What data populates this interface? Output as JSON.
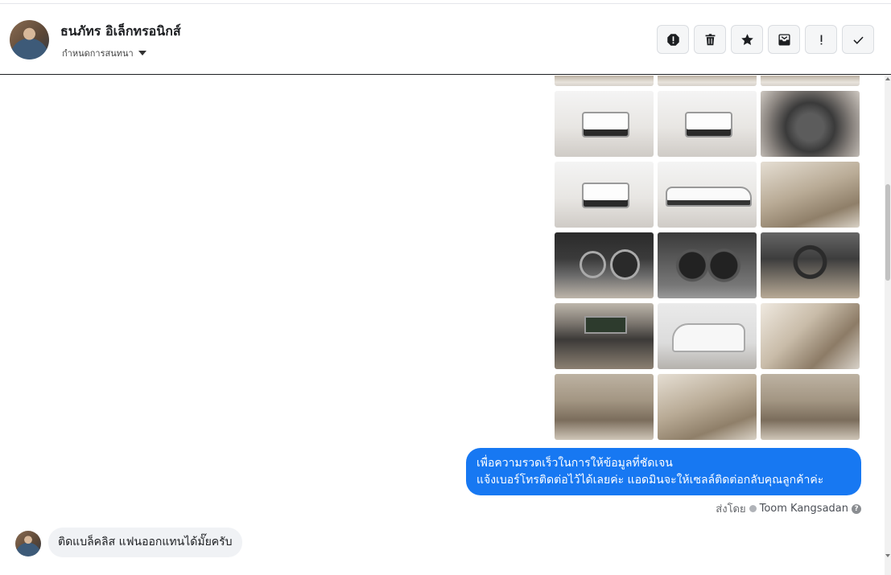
{
  "header": {
    "contact_name": "ธนภัทร อิเล็กทรอนิกส์",
    "conversation_settings_label": "กำหนดการสนทนา",
    "actions": [
      {
        "name": "report-spam-button",
        "icon": "alert-circle-icon"
      },
      {
        "name": "delete-button",
        "icon": "trash-icon"
      },
      {
        "name": "star-button",
        "icon": "star-icon"
      },
      {
        "name": "archive-button",
        "icon": "archive-icon"
      },
      {
        "name": "follow-up-button",
        "icon": "exclamation-icon"
      },
      {
        "name": "mark-done-button",
        "icon": "checkmark-icon"
      }
    ]
  },
  "photos": [
    "partial-top",
    "partial-top",
    "partial-top",
    "truck-rear",
    "truck-rear-angle",
    "engine-bay",
    "truck-front-angle",
    "truck-side",
    "rear-seat",
    "instrument-cluster",
    "gauges",
    "steering-wheel",
    "center-console",
    "truck-front-low",
    "door-panel",
    "interior-front-seats",
    "driver-seat",
    "gear-shift"
  ],
  "messages": {
    "outgoing": {
      "line1": "เพื่อความรวดเร็วในการให้ข้อมูลที่ชัดเจน",
      "line2": "แจ้งเบอร์โทรติดต่อไว้ได้เลยค่ะ แอดมินจะให้เซลล์ติดต่อกลับคุณลูกค้าค่ะ",
      "sent_by_label": "ส่งโดย",
      "sender_name": "Toom Kangsadan"
    },
    "incoming": {
      "text": "ติดแบล็คลิส  แฟนออกแทนได้มั๊ยครับ"
    }
  },
  "colors": {
    "outgoing_bubble": "#1778f2",
    "incoming_bubble": "#f0f2f5"
  }
}
